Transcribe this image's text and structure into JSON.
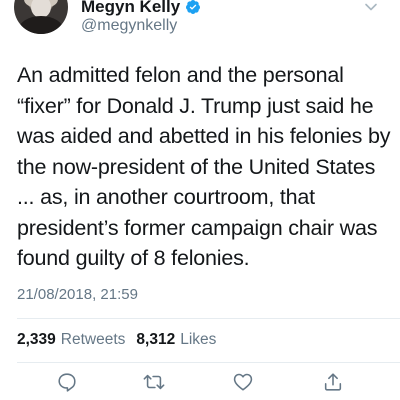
{
  "user": {
    "display_name": "Megyn Kelly",
    "handle": "@megynkelly",
    "verified": true
  },
  "tweet": {
    "text": "An admitted felon and the personal “fixer” for Donald J. Trump just said he was aided and abetted in his felonies by the now-president of the United States ... as, in another courtroom, that president’s former campaign chair was found guilty of 8 felonies.",
    "timestamp": "21/08/2018, 21:59"
  },
  "stats": {
    "retweets_count": "2,339",
    "retweets_label": "Retweets",
    "likes_count": "8,312",
    "likes_label": "Likes"
  },
  "icons": {
    "verified": "verified-badge-icon",
    "menu": "chevron-down-icon",
    "reply": "reply-icon",
    "retweet": "retweet-icon",
    "like": "heart-icon",
    "share": "share-icon"
  },
  "colors": {
    "accent": "#1da1f2",
    "secondary_text": "#657786",
    "action_icon": "#657786"
  }
}
